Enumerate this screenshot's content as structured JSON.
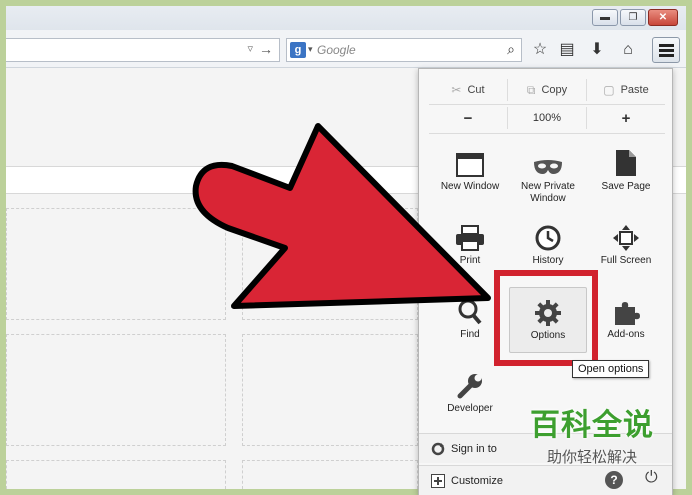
{
  "toolbar": {
    "search_placeholder": "Google",
    "search_engine_badge": "g",
    "icons": [
      "star-icon",
      "reading-list-icon",
      "download-icon",
      "home-icon",
      "hamburger-menu-icon"
    ]
  },
  "window_controls": [
    "minimize",
    "restore",
    "close"
  ],
  "menu": {
    "edit": [
      "Cut",
      "Copy",
      "Paste"
    ],
    "zoom": {
      "minus": "−",
      "level": "100%",
      "plus": "+"
    },
    "tools": [
      {
        "label": "New Window",
        "icon": "new-window-icon"
      },
      {
        "label": "New Private Window",
        "icon": "private-mask-icon"
      },
      {
        "label": "Save Page",
        "icon": "save-page-icon"
      },
      {
        "label": "Print",
        "icon": "printer-icon"
      },
      {
        "label": "History",
        "icon": "clock-icon"
      },
      {
        "label": "Full Screen",
        "icon": "fullscreen-icon"
      },
      {
        "label": "Find",
        "icon": "magnifier-icon"
      },
      {
        "label": "Options",
        "icon": "gear-icon"
      },
      {
        "label": "Add-ons",
        "icon": "puzzle-icon"
      },
      {
        "label": "Developer",
        "icon": "wrench-icon"
      }
    ],
    "sign_in": "Sign in to",
    "customize": "Customize"
  },
  "tooltip": "Open options",
  "watermark": {
    "title": "百科全说",
    "subtitle": "助你轻松解决"
  },
  "colors": {
    "arrow": "#d92535",
    "highlight": "#d1222e",
    "frame": "#bcd19a",
    "watermark": "#3d9f2f"
  }
}
